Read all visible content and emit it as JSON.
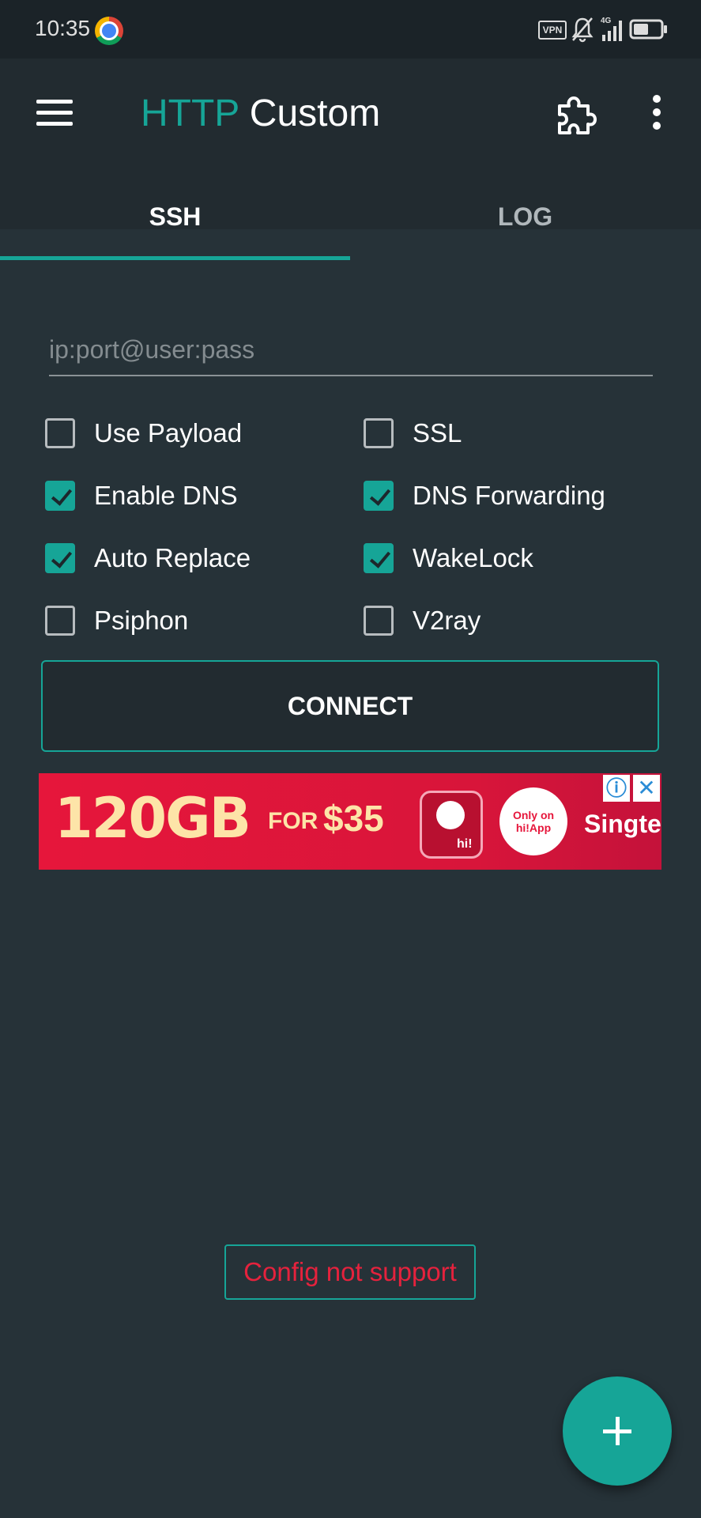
{
  "status_bar": {
    "time": "10:35",
    "vpn_label": "VPN",
    "network_label": "4G",
    "icons": [
      "chrome-icon",
      "vpn-icon",
      "bell-off-icon",
      "signal-icon",
      "battery-icon"
    ]
  },
  "app_bar": {
    "title_accent": "HTTP",
    "title_rest": "Custom",
    "accent_color": "#16a597"
  },
  "tabs": [
    {
      "label": "SSH",
      "selected": true
    },
    {
      "label": "LOG",
      "selected": false
    }
  ],
  "ssh": {
    "server_placeholder": "ip:port@user:pass",
    "server_value": "",
    "options": [
      {
        "label": "Use Payload",
        "checked": false
      },
      {
        "label": "SSL",
        "checked": false
      },
      {
        "label": "Enable DNS",
        "checked": true
      },
      {
        "label": "DNS Forwarding",
        "checked": true
      },
      {
        "label": "Auto Replace",
        "checked": true
      },
      {
        "label": "WakeLock",
        "checked": true
      },
      {
        "label": "Psiphon",
        "checked": false
      },
      {
        "label": "V2ray",
        "checked": false
      }
    ],
    "connect_label": "CONNECT"
  },
  "ad": {
    "headline": "120GB",
    "for_text": "FOR",
    "price": "$35",
    "mascot_text": "hi!",
    "only_text": "Only on hi!App",
    "brand": "Singtel",
    "info_icon": "info-icon",
    "close_icon": "close-icon",
    "bg_color": "#e6163b"
  },
  "status_message": "Config not support",
  "status_color": "#e5223d",
  "fab_icon": "plus-icon"
}
